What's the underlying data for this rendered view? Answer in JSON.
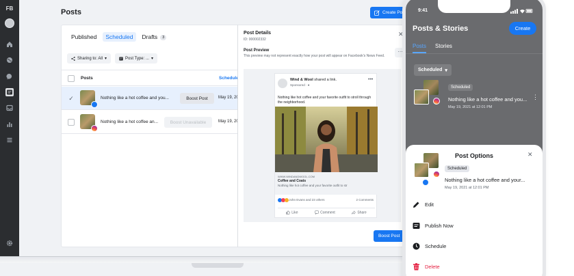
{
  "rail": {
    "brand": "FB",
    "icons": [
      "avatar",
      "home-icon",
      "globe-icon",
      "messenger-icon",
      "posts-icon",
      "inbox-icon",
      "insights-icon",
      "menu-icon",
      "settings-icon"
    ]
  },
  "header": {
    "title": "Posts",
    "create_post": "Create Post"
  },
  "list": {
    "tabs": [
      {
        "label": "Published",
        "active": false
      },
      {
        "label": "Scheduled",
        "active": true
      },
      {
        "label": "Drafts",
        "count": "3",
        "active": false
      }
    ],
    "filters": [
      {
        "label": "Sharing to: All",
        "icon": "share-icon"
      },
      {
        "label": "Post Type: ...",
        "icon": "post-type-icon"
      }
    ],
    "columns": {
      "posts": "Posts",
      "scheduled": "Scheduled"
    },
    "rows": [
      {
        "text": "Nothing like a hot coffee and you...",
        "action": "Boost Post",
        "date": "May 19, 20",
        "selected": true,
        "network": "facebook"
      },
      {
        "text": "Nothing like a hot coffee an...",
        "action": "Boost Unavailable",
        "date": "May 19, 20",
        "selected": false,
        "network": "instagram"
      }
    ]
  },
  "details": {
    "title": "Post Details",
    "id": "ID: 000002332",
    "preview_title": "Post Preview",
    "preview_desc": "This preview may not represent exactly how your post will appear on Facebook's News Feed.",
    "card": {
      "page": "Wind & Wool",
      "shared": "shared a link.",
      "sponsored": "Sponsored · ●",
      "text": "Nothing like hot coffee and your favorite outfit to stroll through the neighborhood.",
      "link_domain": "WWW.WINDANDWOOL.COM",
      "link_title": "Coffee and Coats",
      "link_desc": "Nothing like hot coffee and your favorite outfit to str",
      "reactions": "John Evans and 23 others",
      "comments": "2 Comments",
      "actions": [
        "Like",
        "Comment",
        "Share"
      ]
    },
    "boost_button": "Boost Post"
  },
  "phone": {
    "time": "9:41",
    "title": "Posts & Stories",
    "create": "Create",
    "tabs": [
      {
        "label": "Posts",
        "active": true
      },
      {
        "label": "Stories",
        "active": false
      }
    ],
    "dropdown": "Scheduled",
    "post": {
      "badge": "Scheduled",
      "text": "Nothing like a hot coffee and you...",
      "date": "May 19, 2021 at 12:01 PM"
    },
    "sheet": {
      "title": "Post Options",
      "badge": "Scheduled",
      "text": "Nothing like a hot coffee and your...",
      "date": "May 19, 2021 at 12:01 PM",
      "options": [
        {
          "label": "Edit",
          "icon": "pencil-icon"
        },
        {
          "label": "Publish Now",
          "icon": "publish-icon"
        },
        {
          "label": "Schedule",
          "icon": "clock-icon"
        },
        {
          "label": "Delete",
          "icon": "trash-icon"
        }
      ]
    }
  },
  "colors": {
    "accent": "#1877f2",
    "delete": "#e41e3f",
    "rail": "#2b2d30"
  }
}
